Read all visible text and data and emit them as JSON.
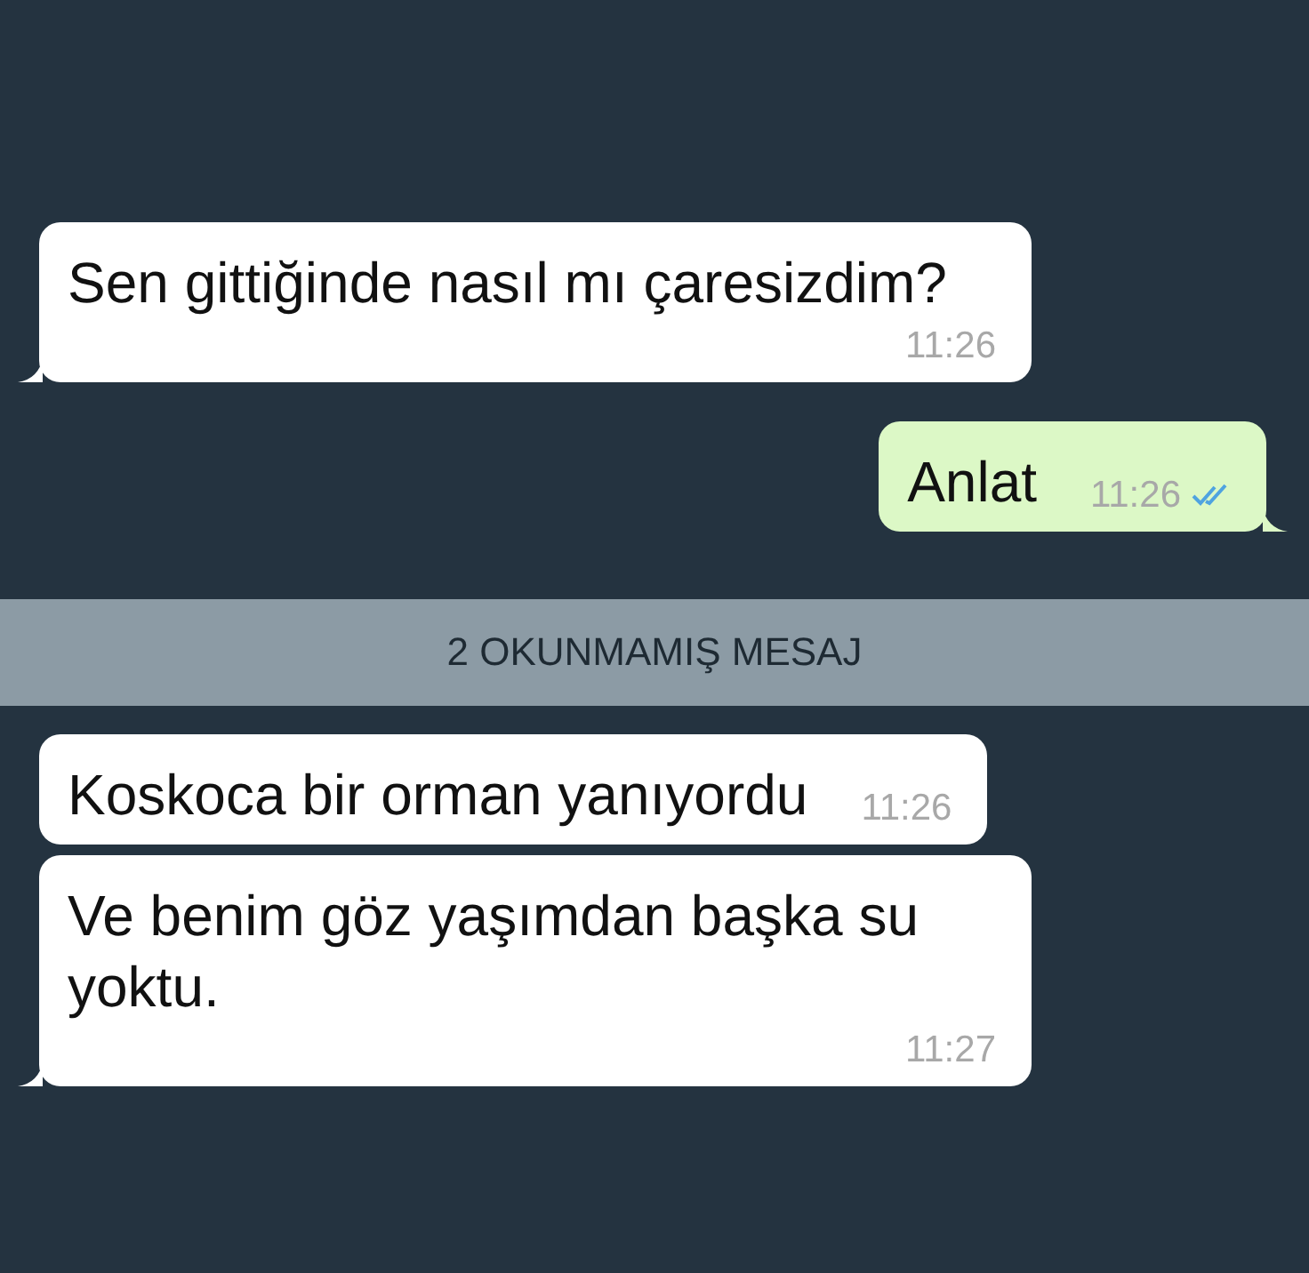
{
  "messages_before": [
    {
      "kind": "in",
      "text": "Sen gittiğinde nasıl mı çaresizdim?",
      "time": "11:26",
      "tail": true
    },
    {
      "kind": "out",
      "text": "Anlat",
      "time": "11:26",
      "tail": true,
      "read": true
    }
  ],
  "unread_divider": {
    "text": "2 OKUNMAMIŞ MESAJ"
  },
  "messages_after": [
    {
      "kind": "in",
      "text": "Koskoca bir orman yanıyordu",
      "time": "11:26",
      "tail": false
    },
    {
      "kind": "in",
      "text": "Ve benim göz yaşımdan başka su yoktu.",
      "time": "11:27",
      "tail": true
    }
  ]
}
